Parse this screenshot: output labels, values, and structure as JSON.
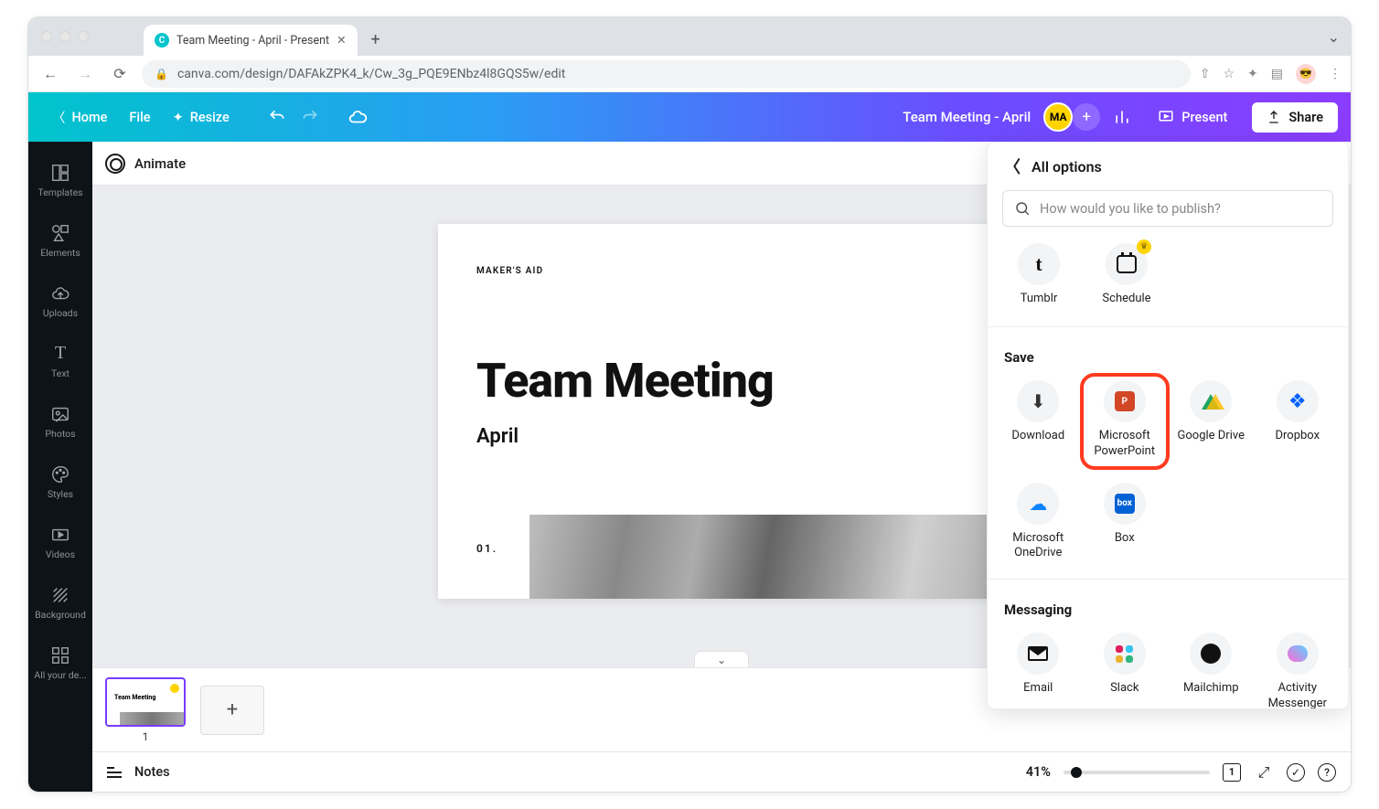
{
  "browser": {
    "tab_title": "Team Meeting - April - Present",
    "url_display": "canva.com/design/DAFAkZPK4_k/Cw_3g_PQE9ENbz4l8GQS5w/edit"
  },
  "topbar": {
    "home": "Home",
    "file": "File",
    "resize": "Resize",
    "doc_title": "Team Meeting - April",
    "avatar_initials": "MA",
    "present": "Present",
    "share": "Share"
  },
  "rail": {
    "templates": "Templates",
    "elements": "Elements",
    "uploads": "Uploads",
    "text": "Text",
    "photos": "Photos",
    "styles": "Styles",
    "videos": "Videos",
    "background": "Background",
    "allyourde": "All your de..."
  },
  "animate_bar": {
    "animate": "Animate"
  },
  "slide": {
    "kicker": "MAKER'S AID",
    "title": "Team Meeting",
    "subtitle": "April",
    "number": "01.",
    "thumb_number": "1",
    "thumb_title": "Team Meeting"
  },
  "footer": {
    "notes": "Notes",
    "zoom": "41%",
    "page_badge": "1"
  },
  "share_panel": {
    "header": "All options",
    "search_placeholder": "How would you like to publish?",
    "row_top": {
      "tumblr": "Tumblr",
      "schedule": "Schedule"
    },
    "save_label": "Save",
    "save_items": {
      "download": "Download",
      "powerpoint": "Microsoft PowerPoint",
      "gdrive": "Google Drive",
      "dropbox": "Dropbox",
      "onedrive": "Microsoft OneDrive",
      "box": "Box"
    },
    "messaging_label": "Messaging",
    "messaging_items": {
      "email": "Email",
      "slack": "Slack",
      "mailchimp": "Mailchimp",
      "activity": "Activity Messenger"
    }
  }
}
